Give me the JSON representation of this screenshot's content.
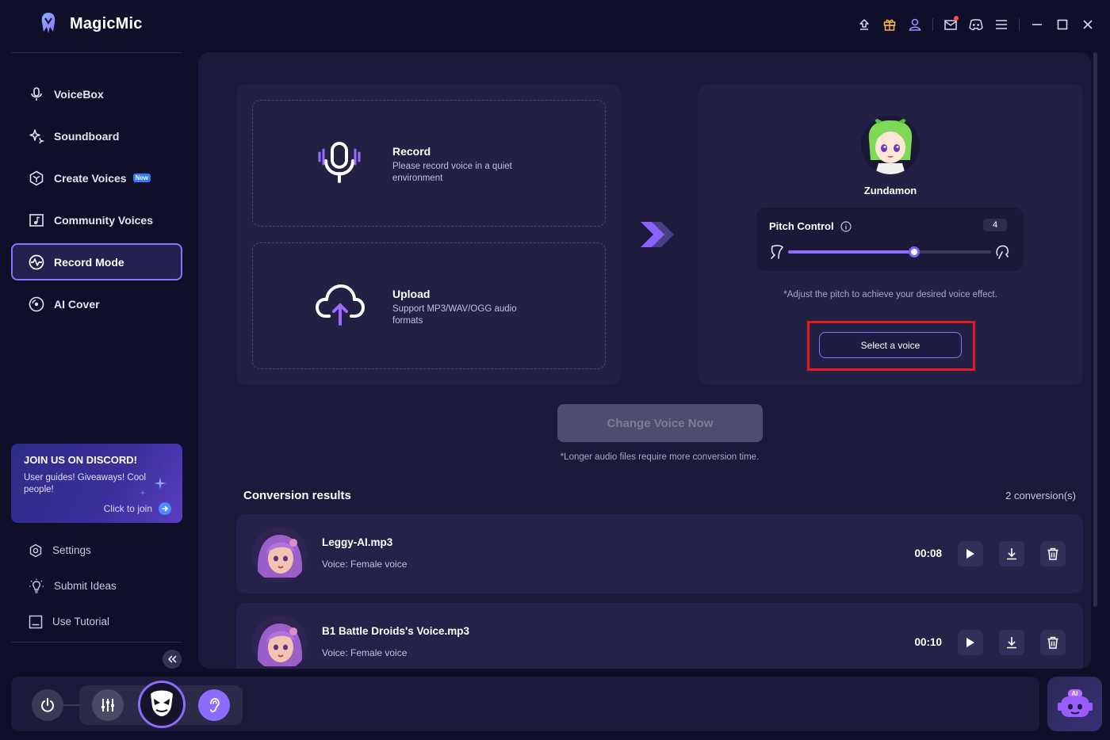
{
  "app": {
    "title": "MagicMic"
  },
  "topbar": {
    "icons": [
      "upload-icon",
      "gift-icon",
      "user-icon",
      "mail-icon",
      "discord-icon",
      "menu-icon",
      "minimize-icon",
      "maximize-icon",
      "close-icon"
    ]
  },
  "sidebar": {
    "items": [
      {
        "label": "VoiceBox",
        "icon": "microphone-icon"
      },
      {
        "label": "Soundboard",
        "icon": "sparkle-icon"
      },
      {
        "label": "Create Voices",
        "icon": "hexagon-icon",
        "badge": "New"
      },
      {
        "label": "Community Voices",
        "icon": "music-folder-icon"
      },
      {
        "label": "Record Mode",
        "icon": "waveform-icon",
        "active": true
      },
      {
        "label": "AI Cover",
        "icon": "disc-icon"
      }
    ],
    "discord": {
      "title": "JOIN US ON DISCORD!",
      "desc": "User guides! Giveaways! Cool people!",
      "join": "Click to join"
    },
    "bottom_items": [
      {
        "label": "Settings",
        "icon": "settings-icon"
      },
      {
        "label": "Submit Ideas",
        "icon": "lightbulb-icon"
      },
      {
        "label": "Use Tutorial",
        "icon": "tutorial-icon"
      }
    ]
  },
  "main": {
    "record": {
      "title": "Record",
      "desc": "Please record voice in a quiet environment"
    },
    "upload": {
      "title": "Upload",
      "desc": "Support MP3/WAV/OGG audio formats"
    },
    "voice": {
      "name": "Zundamon"
    },
    "pitch": {
      "label": "Pitch Control",
      "value": "4",
      "level": 0.62
    },
    "pitch_hint": "*Adjust the pitch to achieve your desired voice effect.",
    "select_voice": "Select a voice",
    "change_voice": "Change Voice Now",
    "long_hint": "*Longer audio files require more conversion time.",
    "results_title": "Conversion results",
    "results_count": "2 conversion(s)",
    "results": [
      {
        "file": "Leggy-AI.mp3",
        "voice": "Voice: Female voice",
        "duration": "00:08"
      },
      {
        "file": "B1 Battle Droids's Voice.mp3",
        "voice": "Voice: Female voice",
        "duration": "00:10"
      }
    ]
  },
  "ai_button": {
    "label": "AI"
  },
  "colors": {
    "accent": "#8c6cff",
    "background": "#100f2a",
    "panel": "#222043",
    "highlight": "#e8171e"
  }
}
